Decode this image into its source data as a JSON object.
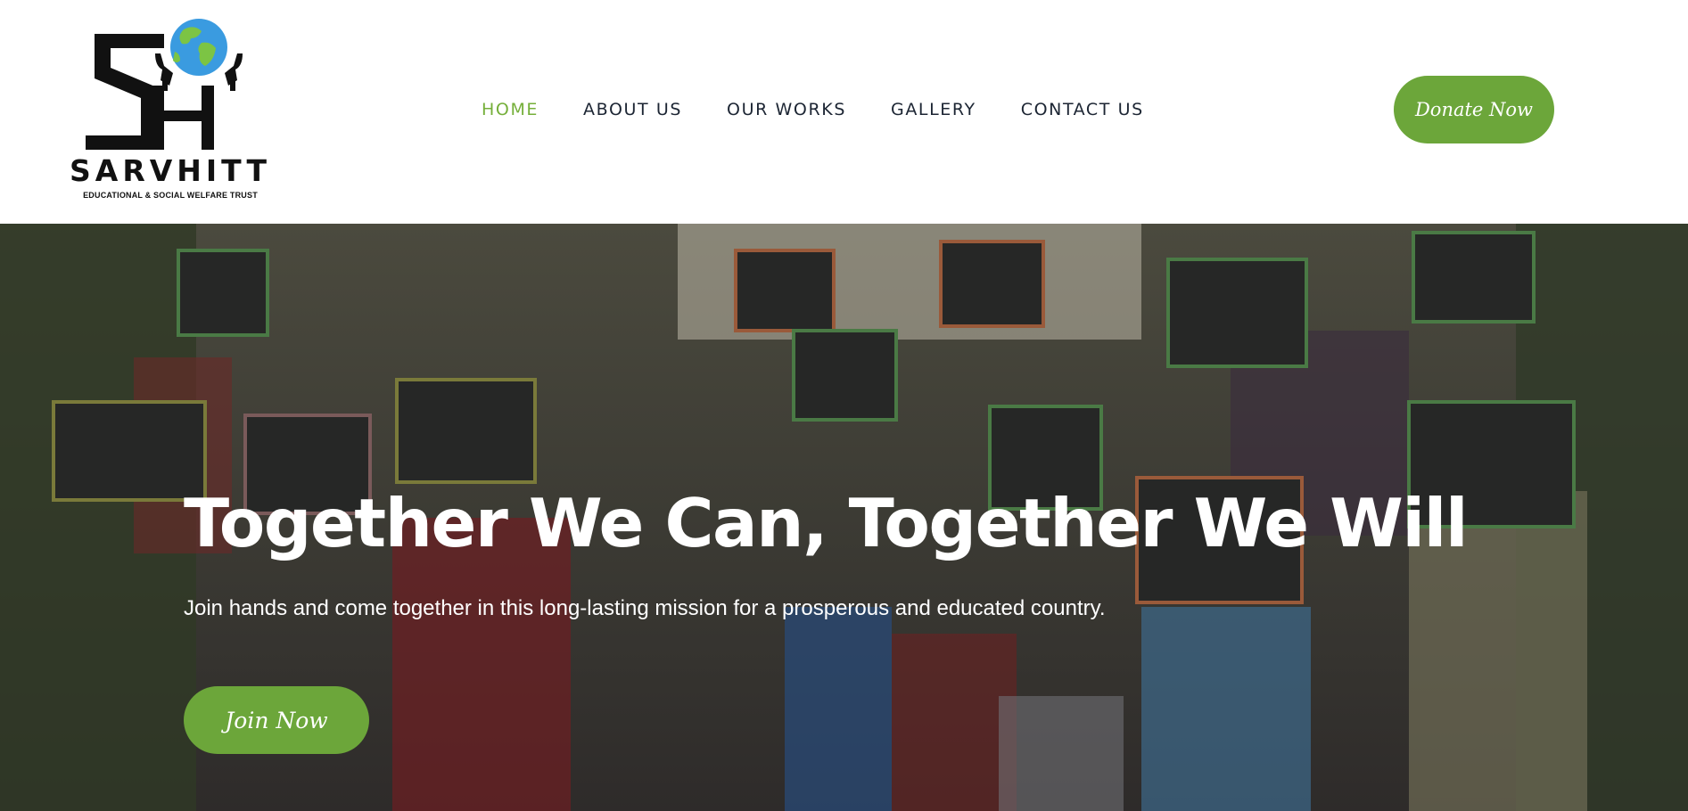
{
  "brand": {
    "name": "SARVHITT",
    "subtitle": "EDUCATIONAL & SOCIAL WELFARE TRUST",
    "logo_icon": "hands-holding-globe-icon"
  },
  "nav": {
    "items": [
      {
        "label": "HOME",
        "active": true
      },
      {
        "label": "ABOUT US",
        "active": false
      },
      {
        "label": "OUR WORKS",
        "active": false
      },
      {
        "label": "GALLERY",
        "active": false
      },
      {
        "label": "CONTACT US",
        "active": false
      }
    ]
  },
  "donate_label": "Donate Now",
  "hero": {
    "title": "Together We Can, Together We Will",
    "subtitle": "Join hands and come together in this long-lasting mission for a prosperous and educated country.",
    "cta_label": "Join Now"
  },
  "colors": {
    "accent": "#6ca63a",
    "nav_active": "#75af3a",
    "nav_text": "#1c2533",
    "header_bg": "#ffffff"
  }
}
